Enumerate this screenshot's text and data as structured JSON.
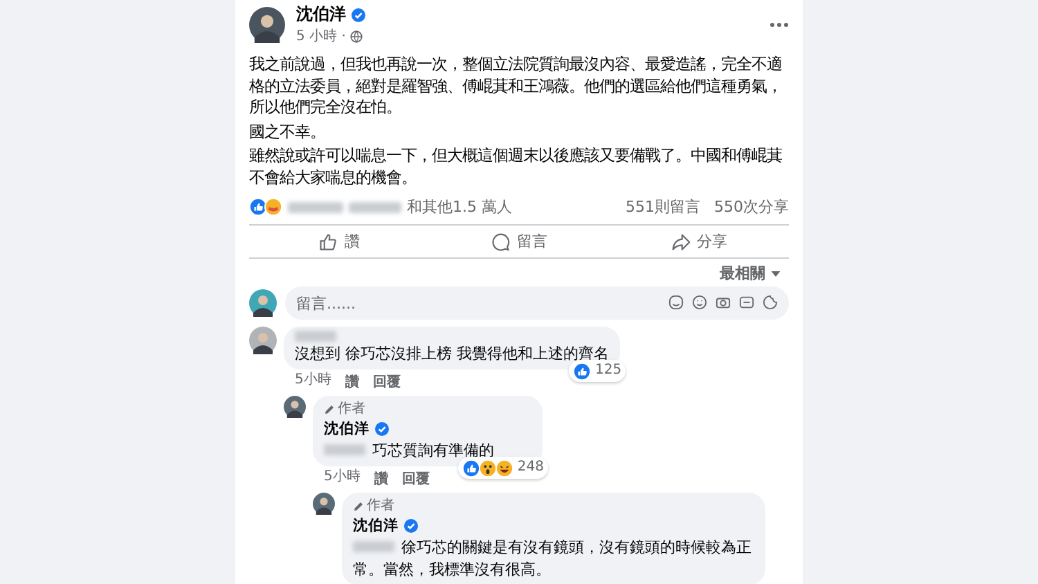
{
  "post": {
    "author": "沈伯洋",
    "verified": true,
    "time": "5 小時 ·",
    "paragraphs": [
      "我之前說過，但我也再說一次，整個立法院質詢最沒內容、最愛造謠，完全不適格的立法委員，絕對是羅智強、傅崐萁和王鴻薇。他們的選區給他們這種勇氣，所以他們完全沒在怕。",
      "國之不幸。",
      "雖然說或許可以喘息一下，但大概這個週末以後應該又要備戰了。中國和傅崐萁不會給大家喘息的機會。"
    ],
    "reactions": [
      {
        "kind": "like"
      },
      {
        "kind": "care"
      }
    ],
    "reactions_text": "和其他1.5 萬人",
    "comments_count": "551則留言",
    "shares_count": "550次分享"
  },
  "actions": [
    {
      "kind": "like",
      "label": "讚"
    },
    {
      "kind": "comment",
      "label": "留言"
    },
    {
      "kind": "share",
      "label": "分享"
    }
  ],
  "sort": {
    "label": "最相關"
  },
  "comment_box": {
    "placeholder": "留言......"
  },
  "comments": [
    {
      "text": "沒想到 徐巧芯沒排上榜 我覺得他和上述的齊名",
      "reactions": [
        {
          "kind": "like"
        }
      ],
      "reaction_count": "125",
      "time": "5小時",
      "actions": [
        "讚",
        "回覆"
      ],
      "children": [
        {
          "badge": "作者",
          "author": "沈伯洋",
          "verified": true,
          "text": "巧芯質詢有準備的",
          "mention": true,
          "reactions": [
            {
              "kind": "like"
            },
            {
              "kind": "wow"
            },
            {
              "kind": "haha"
            }
          ],
          "reaction_count": "248",
          "time": "5小時",
          "actions": [
            "讚",
            "回覆"
          ],
          "children": [
            {
              "badge": "作者",
              "author": "沈伯洋",
              "verified": true,
              "text": "徐巧芯的關鍵是有沒有鏡頭，沒有鏡頭的時候較為正常。當然，我標準沒有很高。",
              "mention": true
            }
          ]
        }
      ]
    }
  ]
}
